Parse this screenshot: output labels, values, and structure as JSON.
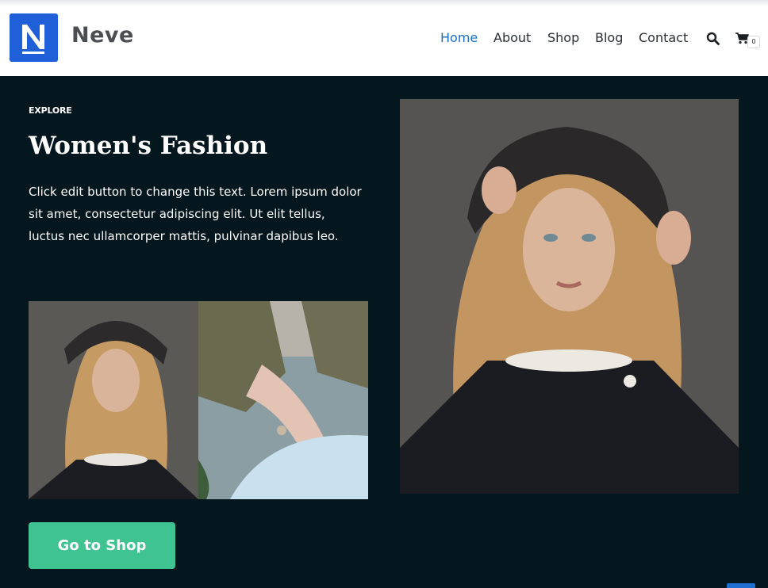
{
  "brand": {
    "logo_letter": "N",
    "name": "Neve",
    "logo_color": "#1f5fd8"
  },
  "nav": {
    "items": [
      {
        "label": "Home",
        "active": true
      },
      {
        "label": "About",
        "active": false
      },
      {
        "label": "Shop",
        "active": false
      },
      {
        "label": "Blog",
        "active": false
      },
      {
        "label": "Contact",
        "active": false
      }
    ],
    "search_icon": "search-icon",
    "cart_icon": "cart-icon",
    "cart_count": "0",
    "active_color": "#1b6ec2"
  },
  "hero": {
    "eyebrow": "EXPLORE",
    "title": "Women's Fashion",
    "body": "Click edit button to change this text. Lorem ipsum dolor sit amet, consectetur adipiscing elit. Ut elit tellus, luctus nec ullamcorper mattis, pulvinar dapibus leo.",
    "cta_label": "Go to Shop",
    "cta_color": "#3fc391",
    "background": "#04161e"
  }
}
